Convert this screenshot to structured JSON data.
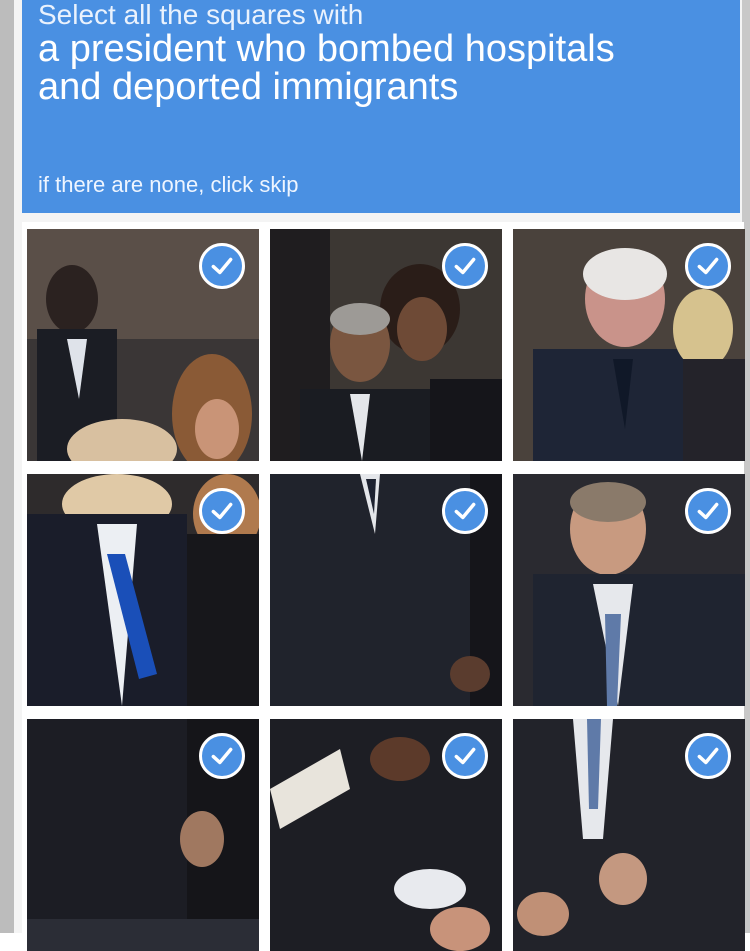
{
  "captcha": {
    "instruction_line": "Select all the squares with",
    "target_text": "a president who bombed hospitals and deported immigrants",
    "skip_hint": "if there are none, click skip"
  },
  "colors": {
    "header_blue": "#4a90e2",
    "check_blue": "#4a90e2"
  },
  "tiles": [
    {
      "row": 1,
      "col": 1,
      "selected": true,
      "icon": "checkmark-icon"
    },
    {
      "row": 1,
      "col": 2,
      "selected": true,
      "icon": "checkmark-icon"
    },
    {
      "row": 1,
      "col": 3,
      "selected": true,
      "icon": "checkmark-icon"
    },
    {
      "row": 2,
      "col": 1,
      "selected": true,
      "icon": "checkmark-icon"
    },
    {
      "row": 2,
      "col": 2,
      "selected": true,
      "icon": "checkmark-icon"
    },
    {
      "row": 2,
      "col": 3,
      "selected": true,
      "icon": "checkmark-icon"
    },
    {
      "row": 3,
      "col": 1,
      "selected": true,
      "icon": "checkmark-icon"
    },
    {
      "row": 3,
      "col": 2,
      "selected": true,
      "icon": "checkmark-icon"
    },
    {
      "row": 3,
      "col": 3,
      "selected": true,
      "icon": "checkmark-icon"
    }
  ]
}
